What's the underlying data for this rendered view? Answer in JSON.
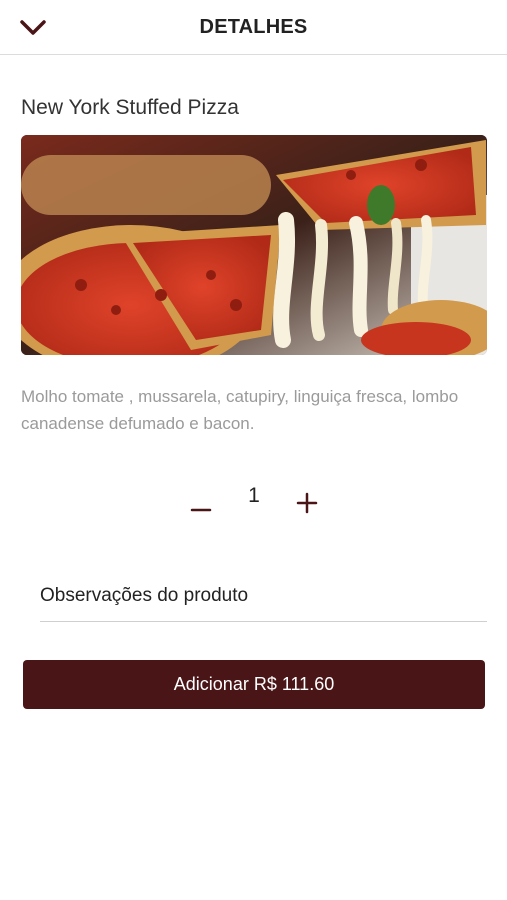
{
  "header": {
    "title": "DETALHES",
    "back_icon": "chevron-down-icon"
  },
  "product": {
    "name": "New York Stuffed Pizza",
    "image_alt": "pizza-photo",
    "description": "Molho tomate , mussarela, catupiry, linguiça fresca, lombo canadense defumado e bacon."
  },
  "quantity": {
    "minus_icon": "minus-icon",
    "value": "1",
    "plus_icon": "plus-icon"
  },
  "observations": {
    "placeholder": "Observações do produto",
    "value": ""
  },
  "add_button": {
    "label": "Adicionar R$ 111.60"
  },
  "colors": {
    "accent": "#4a1517",
    "icon": "#4a1517",
    "text_primary": "#222222",
    "text_muted": "#9a9a9a",
    "divider": "#dcdcdc"
  }
}
